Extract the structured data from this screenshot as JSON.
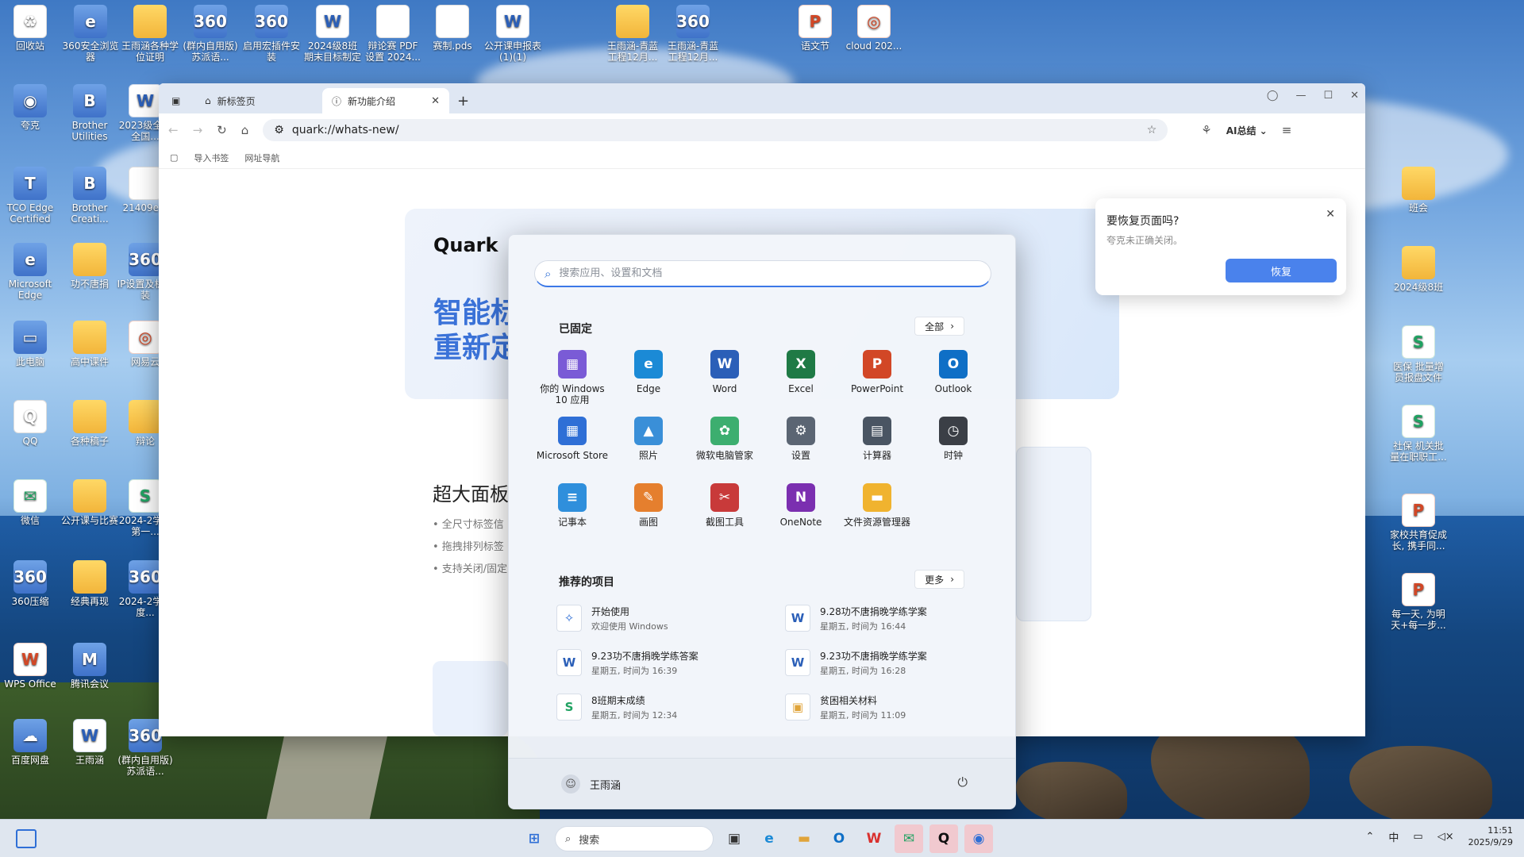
{
  "desktop": {
    "icons_left": [
      {
        "label": "回收站",
        "glyph": "♻",
        "style": "ic-doc"
      },
      {
        "label": "360安全浏览器",
        "glyph": "e",
        "style": "ic-zip"
      },
      {
        "label": "王雨涵各种学位证明",
        "glyph": "",
        "style": "ic-folder"
      },
      {
        "label": "(群内自用版) 苏派语...",
        "glyph": "360",
        "style": "ic-zip"
      },
      {
        "label": "启用宏插件安装",
        "glyph": "360",
        "style": "ic-zip"
      },
      {
        "label": "2024级8班期末目标制定",
        "glyph": "W",
        "style": "ic-word"
      },
      {
        "label": "辩论赛 PDF设置 2024...",
        "glyph": "",
        "style": "ic-doc"
      },
      {
        "label": "赛制.pds",
        "glyph": "",
        "style": "ic-doc"
      },
      {
        "label": "公开课申报表(1)(1)",
        "glyph": "W",
        "style": "ic-word"
      },
      {
        "label": "王雨涵-青蓝工程12月...",
        "glyph": "",
        "style": "ic-folder"
      },
      {
        "label": "王雨涵-青蓝工程12月...",
        "glyph": "360",
        "style": "ic-zip"
      },
      {
        "label": "语文节",
        "glyph": "P",
        "style": "ic-ppt"
      },
      {
        "label": "cloud 202...",
        "glyph": "◎",
        "style": "ic-ppt"
      }
    ],
    "col1": [
      {
        "label": "夸克",
        "glyph": "◉",
        "style": "ic-zip"
      },
      {
        "label": "TCO Edge Certified",
        "glyph": "T",
        "style": "ic-zip"
      },
      {
        "label": "Microsoft Edge",
        "glyph": "e",
        "style": "ic-zip"
      },
      {
        "label": "此电脑",
        "glyph": "▭",
        "style": "ic-zip"
      },
      {
        "label": "QQ",
        "glyph": "Q",
        "style": "ic-doc"
      },
      {
        "label": "微信",
        "glyph": "✉",
        "style": "ic-xls"
      },
      {
        "label": "360压缩",
        "glyph": "360",
        "style": "ic-zip"
      },
      {
        "label": "WPS Office",
        "glyph": "W",
        "style": "ic-ppt"
      },
      {
        "label": "百度网盘",
        "glyph": "☁",
        "style": "ic-zip"
      }
    ],
    "col2": [
      {
        "label": "Brother Utilities",
        "glyph": "B",
        "style": "ic-zip"
      },
      {
        "label": "Brother Creati...",
        "glyph": "B",
        "style": "ic-zip"
      },
      {
        "label": "功不唐捐",
        "glyph": "",
        "style": "ic-folder"
      },
      {
        "label": "高中课件",
        "glyph": "",
        "style": "ic-folder"
      },
      {
        "label": "各种稿子",
        "glyph": "",
        "style": "ic-folder"
      },
      {
        "label": "公开课与比赛",
        "glyph": "",
        "style": "ic-folder"
      },
      {
        "label": "经典再现",
        "glyph": "",
        "style": "ic-folder"
      },
      {
        "label": "腾讯会议",
        "glyph": "M",
        "style": "ic-zip"
      },
      {
        "label": "王雨涵",
        "glyph": "W",
        "style": "ic-word"
      }
    ],
    "col3": [
      {
        "label": "2023级全年全国...",
        "glyph": "W",
        "style": "ic-word"
      },
      {
        "label": "21409e...",
        "glyph": "",
        "style": "ic-doc"
      },
      {
        "label": "IP设置及机安装",
        "glyph": "360",
        "style": "ic-zip"
      },
      {
        "label": "网易云",
        "glyph": "◎",
        "style": "ic-ppt"
      },
      {
        "label": "辩论",
        "glyph": "",
        "style": "ic-folder"
      },
      {
        "label": "2024-2学年第一...",
        "glyph": "S",
        "style": "ic-xls"
      },
      {
        "label": "2024-2学年度...",
        "glyph": "360",
        "style": "ic-zip"
      },
      {
        "label": "(群内自用版) 苏派语...",
        "glyph": "360",
        "style": "ic-zip"
      }
    ],
    "right": [
      {
        "label": "班会",
        "glyph": "",
        "style": "ic-folder"
      },
      {
        "label": "2024级8班",
        "glyph": "",
        "style": "ic-folder"
      },
      {
        "label": "医保 批量增员报盘文件",
        "glyph": "S",
        "style": "ic-xls"
      },
      {
        "label": "社保 机关批量在职职工...",
        "glyph": "S",
        "style": "ic-xls"
      },
      {
        "label": "家校共育促成长, 携手同...",
        "glyph": "P",
        "style": "ic-ppt"
      },
      {
        "label": "每一天, 为明天+每一步...",
        "glyph": "P",
        "style": "ic-ppt"
      }
    ]
  },
  "browser": {
    "tabs": [
      {
        "label": "新标签页",
        "active": false
      },
      {
        "label": "新功能介绍",
        "active": true
      }
    ],
    "new_tab": "+",
    "url": "quark://whats-new/",
    "ai_button": "AI总结",
    "bookmarks": [
      "导入书签",
      "网址导航"
    ],
    "page": {
      "brand": "Quark",
      "hero_title": "智能标\n重新定",
      "section_title": "超大面板",
      "bullets": [
        "• 全尺寸标签信",
        "• 拖拽排列标签",
        "• 支持关闭/固定"
      ]
    }
  },
  "restore": {
    "title": "要恢复页面吗?",
    "subtitle": "夸克未正确关闭。",
    "button": "恢复"
  },
  "start_menu": {
    "search_placeholder": "搜索应用、设置和文档",
    "pinned_title": "已固定",
    "all_label": "全部",
    "pinned": [
      {
        "label": "你的 Windows 10 应用",
        "glyph": "▦",
        "color": "#7a5bd6"
      },
      {
        "label": "Edge",
        "glyph": "e",
        "color": "#1b8ad6"
      },
      {
        "label": "Word",
        "glyph": "W",
        "color": "#2b5fb8"
      },
      {
        "label": "Excel",
        "glyph": "X",
        "color": "#1f7a45"
      },
      {
        "label": "PowerPoint",
        "glyph": "P",
        "color": "#d24726"
      },
      {
        "label": "Outlook",
        "glyph": "O",
        "color": "#0f6fc6"
      },
      {
        "label": "Microsoft Store",
        "glyph": "▦",
        "color": "#2f6fd6"
      },
      {
        "label": "照片",
        "glyph": "▲",
        "color": "#3a8fd8"
      },
      {
        "label": "微软电脑管家",
        "glyph": "✿",
        "color": "#3cae6f"
      },
      {
        "label": "设置",
        "glyph": "⚙",
        "color": "#5b6573"
      },
      {
        "label": "计算器",
        "glyph": "▤",
        "color": "#4a5563"
      },
      {
        "label": "时钟",
        "glyph": "◷",
        "color": "#3b3f46"
      },
      {
        "label": "记事本",
        "glyph": "≡",
        "color": "#2f8fdc"
      },
      {
        "label": "画图",
        "glyph": "✎",
        "color": "#e57f2e"
      },
      {
        "label": "截图工具",
        "glyph": "✂",
        "color": "#c83a3a"
      },
      {
        "label": "OneNote",
        "glyph": "N",
        "color": "#7b2fb0"
      },
      {
        "label": "文件资源管理器",
        "glyph": "▬",
        "color": "#f0b32f"
      }
    ],
    "recommended_title": "推荐的项目",
    "more_label": "更多",
    "recommended": [
      {
        "name": "开始使用",
        "detail": "欢迎使用 Windows",
        "glyph": "✧",
        "color": "#2f6fd6"
      },
      {
        "name": "9.28功不唐捐晚学练学案",
        "detail": "星期五, 时间为 16:44",
        "glyph": "W",
        "color": "#2b5fb8"
      },
      {
        "name": "9.23功不唐捐晚学练答案",
        "detail": "星期五, 时间为 16:39",
        "glyph": "W",
        "color": "#2b5fb8"
      },
      {
        "name": "9.23功不唐捐晚学练学案",
        "detail": "星期五, 时间为 16:28",
        "glyph": "W",
        "color": "#2b5fb8"
      },
      {
        "name": "8班期末成绩",
        "detail": "星期五, 时间为 12:34",
        "glyph": "S",
        "color": "#20a262"
      },
      {
        "name": "贫困相关材料",
        "detail": "星期五, 时间为 11:09",
        "glyph": "▣",
        "color": "#e0a43a"
      }
    ],
    "user": "王雨涵"
  },
  "taskbar": {
    "search_label": "搜索",
    "ime": "中",
    "time": "11:51",
    "date": "2025/9/29"
  }
}
